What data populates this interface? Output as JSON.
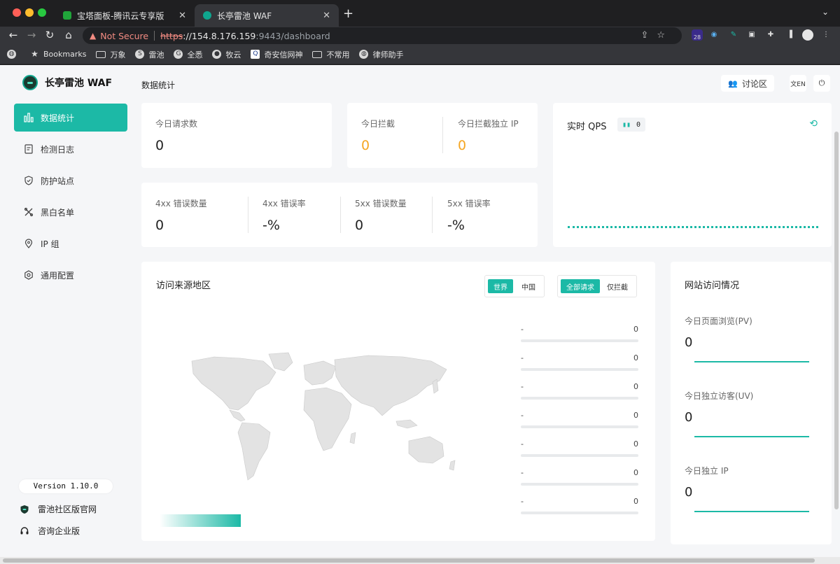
{
  "browser": {
    "tabs": [
      {
        "title": "宝塔面板-腾讯云专享版",
        "favicon_color": "#20a53a",
        "active": false
      },
      {
        "title": "长亭雷池 WAF",
        "favicon_color": "#0fa68e",
        "active": true
      }
    ],
    "url": {
      "security_label": "Not Secure",
      "scheme": "https",
      "host": "://154.8.176.159",
      "path": ":9443/dashboard"
    },
    "extension_badge": "28",
    "bookmarks": [
      {
        "label": "Bookmarks",
        "icon": "star-icon"
      },
      {
        "label": "万象",
        "icon": "folder-icon"
      },
      {
        "label": "雷池",
        "icon": "site-icon"
      },
      {
        "label": "全悉",
        "icon": "site-icon"
      },
      {
        "label": "牧云",
        "icon": "site-icon"
      },
      {
        "label": "奇安信网神",
        "icon": "site-icon"
      },
      {
        "label": "不常用",
        "icon": "folder-icon"
      },
      {
        "label": "律师助手",
        "icon": "globe-icon"
      }
    ]
  },
  "app": {
    "brand": "长亭雷池 WAF",
    "accent_color": "#1cb9a6",
    "warn_color": "#f5a623",
    "nav": [
      {
        "label": "数据统计",
        "icon": "bar-chart-icon",
        "active": true
      },
      {
        "label": "检测日志",
        "icon": "log-icon",
        "active": false
      },
      {
        "label": "防护站点",
        "icon": "shield-icon",
        "active": false
      },
      {
        "label": "黑白名单",
        "icon": "tools-icon",
        "active": false
      },
      {
        "label": "IP 组",
        "icon": "location-icon",
        "active": false
      },
      {
        "label": "通用配置",
        "icon": "settings-icon",
        "active": false
      }
    ],
    "version": "Version 1.10.0",
    "community_link": "雷池社区版官网",
    "enterprise_link": "咨询企业版"
  },
  "header": {
    "title": "数据统计",
    "discuss_label": "讨论区",
    "lang_label": "文EN"
  },
  "stats": {
    "requests": {
      "label": "今日请求数",
      "value": "0"
    },
    "blocked": {
      "label": "今日拦截",
      "value": "0"
    },
    "blocked_ip": {
      "label": "今日拦截独立 IP",
      "value": "0"
    },
    "err4_count": {
      "label": "4xx 错误数量",
      "value": "0"
    },
    "err4_rate": {
      "label": "4xx 错误率",
      "value": "-%"
    },
    "err5_count": {
      "label": "5xx 错误数量",
      "value": "0"
    },
    "err5_rate": {
      "label": "5xx 错误率",
      "value": "-%"
    }
  },
  "qps": {
    "title": "实时 QPS",
    "value": "0"
  },
  "geo": {
    "title": "访问来源地区",
    "scope_options": [
      "世界",
      "中国"
    ],
    "scope_selected": "世界",
    "filter_options": [
      "全部请求",
      "仅拦截"
    ],
    "filter_selected": "全部请求",
    "ranking": [
      {
        "name": "-",
        "value": "0"
      },
      {
        "name": "-",
        "value": "0"
      },
      {
        "name": "-",
        "value": "0"
      },
      {
        "name": "-",
        "value": "0"
      },
      {
        "name": "-",
        "value": "0"
      },
      {
        "name": "-",
        "value": "0"
      },
      {
        "name": "-",
        "value": "0"
      }
    ]
  },
  "site": {
    "title": "网站访问情况",
    "pv": {
      "label": "今日页面浏览(PV)",
      "value": "0"
    },
    "uv": {
      "label": "今日独立访客(UV)",
      "value": "0"
    },
    "ip": {
      "label": "今日独立 IP",
      "value": "0"
    }
  }
}
